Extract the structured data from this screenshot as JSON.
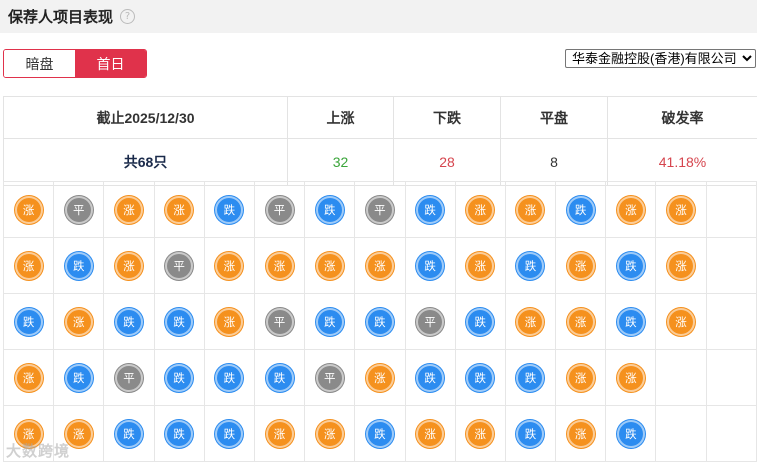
{
  "header": {
    "title": "保荐人项目表现",
    "help_glyph": "?"
  },
  "tabs": [
    {
      "label": "暗盘",
      "active": false
    },
    {
      "label": "首日",
      "active": true
    }
  ],
  "sponsor_select": {
    "selected": "华泰金融控股(香港)有限公司"
  },
  "summary": {
    "date_header": "截止2025/12/30",
    "rise_header": "上涨",
    "fall_header": "下跌",
    "flat_header": "平盘",
    "break_header": "破发率",
    "total": "共68只",
    "rise_count": "32",
    "fall_count": "28",
    "flat_count": "8",
    "break_rate": "41.18%"
  },
  "badge_labels": {
    "rise": "涨",
    "fall": "跌",
    "flat": "平"
  },
  "grid": [
    [
      "rise",
      "flat",
      "rise",
      "rise",
      "fall",
      "flat",
      "fall",
      "flat",
      "fall",
      "rise",
      "rise",
      "fall",
      "rise",
      "rise",
      ""
    ],
    [
      "rise",
      "fall",
      "rise",
      "flat",
      "rise",
      "rise",
      "rise",
      "rise",
      "fall",
      "rise",
      "fall",
      "rise",
      "fall",
      "rise",
      ""
    ],
    [
      "fall",
      "rise",
      "fall",
      "fall",
      "rise",
      "flat",
      "fall",
      "fall",
      "flat",
      "fall",
      "rise",
      "rise",
      "fall",
      "rise",
      ""
    ],
    [
      "rise",
      "fall",
      "flat",
      "fall",
      "fall",
      "fall",
      "flat",
      "rise",
      "fall",
      "fall",
      "fall",
      "rise",
      "rise",
      "",
      ""
    ],
    [
      "rise",
      "rise",
      "fall",
      "fall",
      "fall",
      "rise",
      "rise",
      "fall",
      "rise",
      "rise",
      "fall",
      "rise",
      "fall",
      "",
      ""
    ]
  ],
  "colors": {
    "rise": "#f5911e",
    "fall": "#2c8cf0",
    "flat": "#8a8a8a",
    "accent": "#e0324b",
    "up_text": "#3aa53a",
    "down_text": "#d6454e"
  },
  "watermark": "大数跨境"
}
